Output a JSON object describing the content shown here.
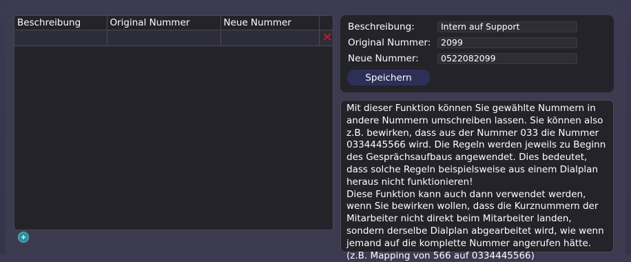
{
  "table": {
    "columns": [
      "Beschreibung",
      "Original Nummer",
      "Neue Nummer"
    ],
    "rows": [
      {
        "beschreibung": "",
        "original": "",
        "neu": ""
      }
    ],
    "delete_icon": "close-icon"
  },
  "form": {
    "beschreibung_label": "Beschreibung:",
    "beschreibung_value": "Intern auf Support",
    "original_label": "Original Nummer:",
    "original_value": "2099",
    "neu_label": "Neue Nummer:",
    "neu_value": "0522082099",
    "save_label": "Speichern"
  },
  "info_text": "Mit dieser Funktion können Sie gewählte Nummern in andere Nummern umschreiben lassen. Sie können also z.B. bewirken, dass aus der Nummer 033 die Nummer 0334445566 wird. Die Regeln werden jeweils zu Beginn des Gesprächsaufbaus angewendet. Dies bedeutet, dass solche Regeln beispielsweise aus einem Dialplan heraus nicht funktionieren!\nDiese Funktion kann auch dann verwendet werden, wenn Sie bewirken wollen, dass die Kurznummern der Mitarbeiter nicht direkt beim Mitarbeiter landen, sondern derselbe Dialplan abgearbeitet wird, wie wenn jemand auf die komplette Nummer angerufen hätte. (z.B. Mapping von 566 auf 0334445566)",
  "colors": {
    "background": "#3c3b4f",
    "panel": "#232329",
    "accent_button": "#2e2f58",
    "delete": "#d11b20",
    "add": "#2b8f9a"
  },
  "add_icon": "plus-circle-icon"
}
